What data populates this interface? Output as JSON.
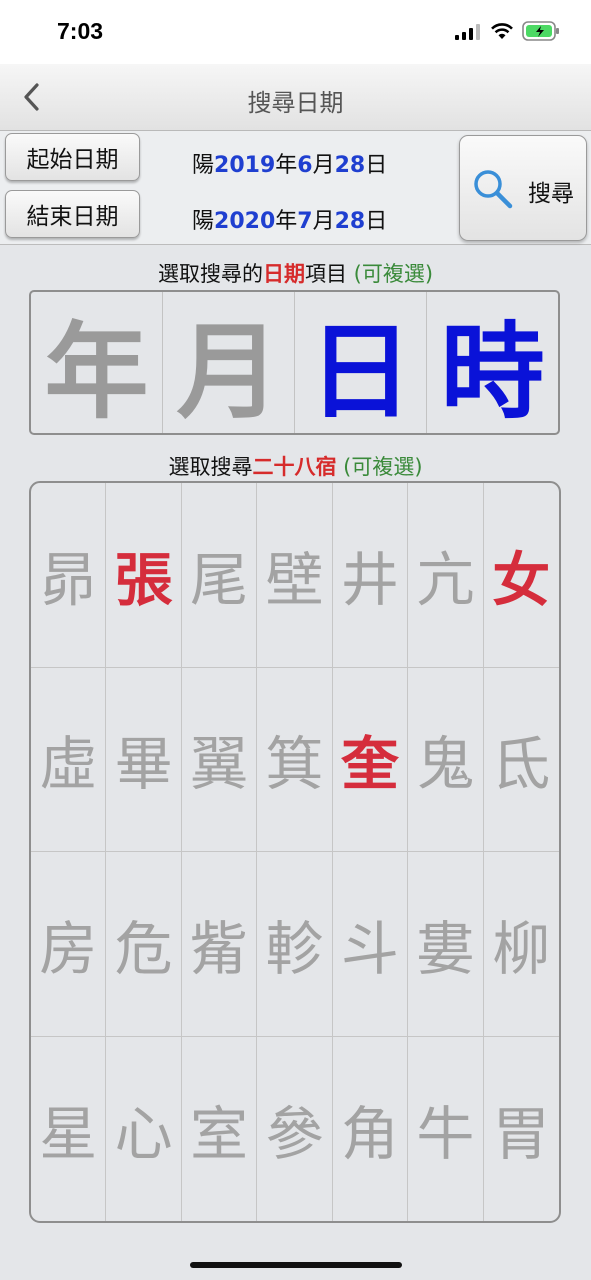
{
  "status_bar": {
    "time": "7:03",
    "battery_color": "#4cd964"
  },
  "nav": {
    "title": "搜尋日期",
    "back_icon": "chevron-left-icon"
  },
  "date_panel": {
    "start_button": "起始日期",
    "end_button": "結束日期",
    "start": {
      "prefix": "陽",
      "year": "2019",
      "year_unit": "年",
      "month": "6",
      "month_unit": "月",
      "day": "28",
      "day_unit": "日"
    },
    "end": {
      "prefix": "陽",
      "year": "2020",
      "year_unit": "年",
      "month": "7",
      "month_unit": "月",
      "day": "28",
      "day_unit": "日"
    },
    "search_label": "搜尋",
    "search_icon": "search-icon"
  },
  "unit_section": {
    "title_pre": "選取搜尋的",
    "title_hl": "日期",
    "title_post": "項目",
    "title_note": "(可複選)",
    "items": [
      {
        "label": "年",
        "selected": false
      },
      {
        "label": "月",
        "selected": false
      },
      {
        "label": "日",
        "selected": true
      },
      {
        "label": "時",
        "selected": true
      }
    ]
  },
  "mansion_section": {
    "title_pre": "選取搜尋",
    "title_hl": "二十八宿",
    "title_note": "(可複選)",
    "items": [
      {
        "label": "昴",
        "selected": false
      },
      {
        "label": "張",
        "selected": true
      },
      {
        "label": "尾",
        "selected": false
      },
      {
        "label": "壁",
        "selected": false
      },
      {
        "label": "井",
        "selected": false
      },
      {
        "label": "亢",
        "selected": false
      },
      {
        "label": "女",
        "selected": true
      },
      {
        "label": "虛",
        "selected": false
      },
      {
        "label": "畢",
        "selected": false
      },
      {
        "label": "翼",
        "selected": false
      },
      {
        "label": "箕",
        "selected": false
      },
      {
        "label": "奎",
        "selected": true
      },
      {
        "label": "鬼",
        "selected": false
      },
      {
        "label": "氐",
        "selected": false
      },
      {
        "label": "房",
        "selected": false
      },
      {
        "label": "危",
        "selected": false
      },
      {
        "label": "觜",
        "selected": false
      },
      {
        "label": "軫",
        "selected": false
      },
      {
        "label": "斗",
        "selected": false
      },
      {
        "label": "婁",
        "selected": false
      },
      {
        "label": "柳",
        "selected": false
      },
      {
        "label": "星",
        "selected": false
      },
      {
        "label": "心",
        "selected": false
      },
      {
        "label": "室",
        "selected": false
      },
      {
        "label": "參",
        "selected": false
      },
      {
        "label": "角",
        "selected": false
      },
      {
        "label": "牛",
        "selected": false
      },
      {
        "label": "胃",
        "selected": false
      }
    ]
  },
  "colors": {
    "selected_unit": "#0a12d8",
    "selected_mansion": "#d52d3c",
    "highlight_red": "#d62b2b",
    "note_green": "#3a8a3a",
    "date_number_blue": "#1f3fd0"
  }
}
